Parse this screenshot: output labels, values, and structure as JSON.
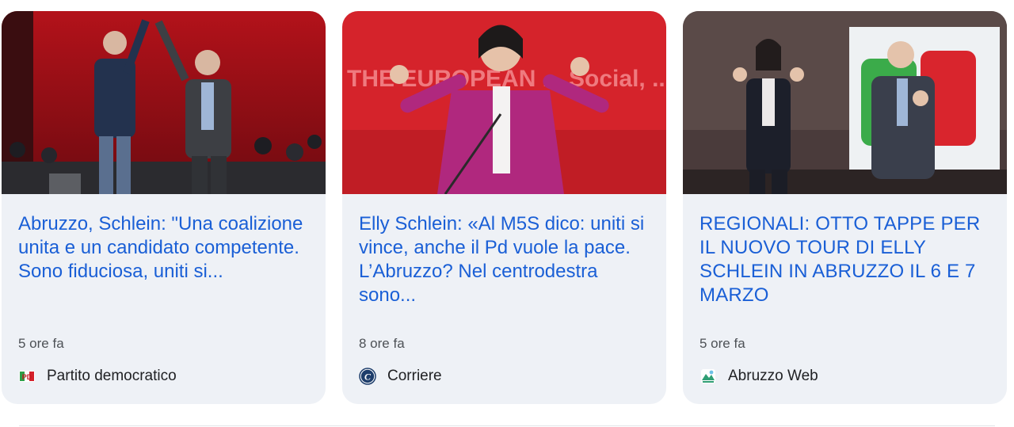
{
  "cards": [
    {
      "headline": "Abruzzo, Schlein: \"Una coalizione unita e un candidato competente. Sono fiduciosa, uniti si...",
      "age": "5 ore fa",
      "source": "Partito democratico",
      "favicon": "pd-logo-icon"
    },
    {
      "headline": "Elly Schlein: «Al M5S dico: uniti si vince, anche il Pd vuole la pace. L’Abruzzo? Nel centrodestra sono...",
      "age": "8 ore fa",
      "source": "Corriere",
      "favicon": "corriere-logo-icon"
    },
    {
      "headline": "REGIONALI: OTTO TAPPE PER IL NUOVO TOUR DI ELLY SCHLEIN IN ABRUZZO IL 6 E 7 MARZO",
      "age": "5 ore fa",
      "source": "Abruzzo Web",
      "favicon": "abruzzoweb-logo-icon"
    }
  ],
  "thumbnails": [
    {
      "banner_text": ""
    },
    {
      "banner_text": "THE EUROPEAN ... Social, ... Democratic ..."
    },
    {
      "banner_text": ""
    }
  ],
  "colors": {
    "headline": "#1a5fd6",
    "card_bg": "#eef1f6",
    "meta_text": "#4d5156"
  }
}
